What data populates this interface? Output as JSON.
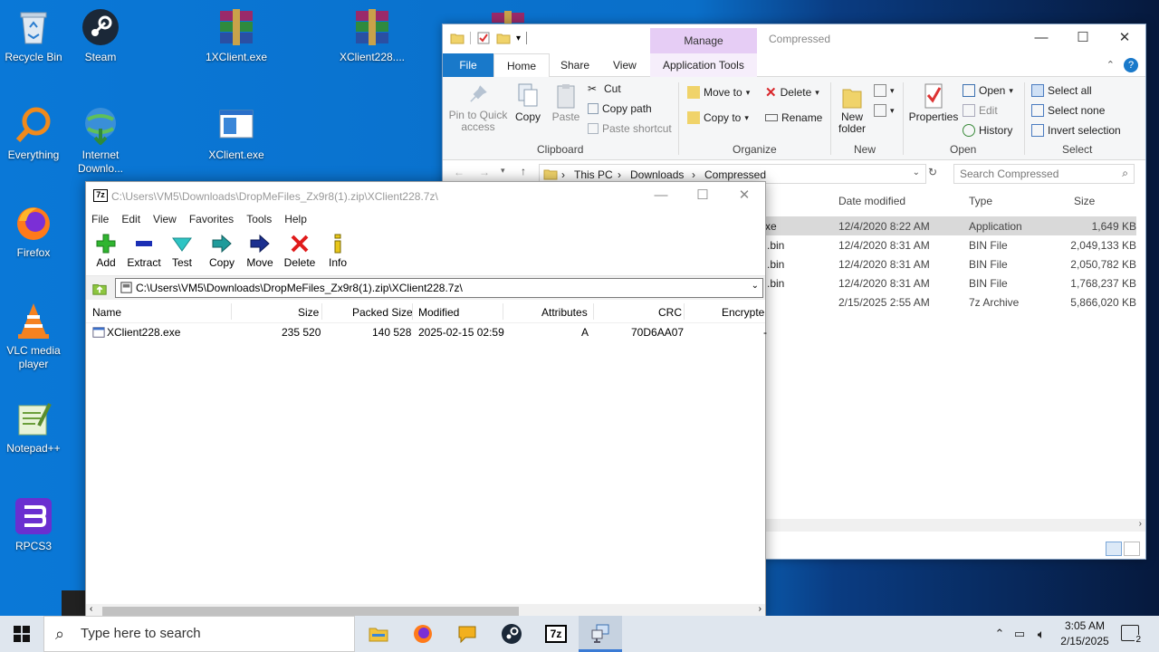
{
  "desktop": {
    "icons": [
      {
        "label": "Recycle Bin"
      },
      {
        "label": "Steam"
      },
      {
        "label": "1XClient.exe"
      },
      {
        "label": "XClient228...."
      },
      {
        "label": "Everything"
      },
      {
        "label": "Internet Downlo..."
      },
      {
        "label": "XClient.exe"
      },
      {
        "label": "Firefox"
      },
      {
        "label": "VLC media player"
      },
      {
        "label": "Notepad++"
      },
      {
        "label": "RPCS3"
      }
    ]
  },
  "explorer": {
    "title": "Compressed",
    "manage_tab": "Manage",
    "tabs": [
      "File",
      "Home",
      "Share",
      "View",
      "Application Tools"
    ],
    "ribbon": {
      "pin": "Pin to Quick access",
      "copy": "Copy",
      "paste": "Paste",
      "cut": "Cut",
      "copy_path": "Copy path",
      "paste_shortcut": "Paste shortcut",
      "group_clipboard": "Clipboard",
      "move_to": "Move to",
      "copy_to": "Copy to",
      "delete": "Delete",
      "rename": "Rename",
      "group_organize": "Organize",
      "new_folder": "New folder",
      "group_new": "New",
      "properties": "Properties",
      "open": "Open",
      "edit": "Edit",
      "history": "History",
      "group_open": "Open",
      "select_all": "Select all",
      "select_none": "Select none",
      "invert_selection": "Invert selection",
      "group_select": "Select"
    },
    "breadcrumb": [
      "This PC",
      "Downloads",
      "Compressed"
    ],
    "search_placeholder": "Search Compressed",
    "columns": {
      "modified": "Date modified",
      "type": "Type",
      "size": "Size"
    },
    "rows": [
      {
        "name": "xe",
        "modified": "12/4/2020 8:22 AM",
        "type": "Application",
        "size": "1,649 KB"
      },
      {
        "name": ".bin",
        "modified": "12/4/2020 8:31 AM",
        "type": "BIN File",
        "size": "2,049,133 KB"
      },
      {
        "name": ".bin",
        "modified": "12/4/2020 8:31 AM",
        "type": "BIN File",
        "size": "2,050,782 KB"
      },
      {
        "name": ".bin",
        "modified": "12/4/2020 8:31 AM",
        "type": "BIN File",
        "size": "1,768,237 KB"
      },
      {
        "name": "",
        "modified": "2/15/2025 2:55 AM",
        "type": "7z Archive",
        "size": "5,866,020 KB"
      }
    ]
  },
  "sevenzip": {
    "title": "C:\\Users\\VM5\\Downloads\\DropMeFiles_Zx9r8(1).zip\\XClient228.7z\\",
    "menu": [
      "File",
      "Edit",
      "View",
      "Favorites",
      "Tools",
      "Help"
    ],
    "tools": [
      "Add",
      "Extract",
      "Test",
      "Copy",
      "Move",
      "Delete",
      "Info"
    ],
    "path": "C:\\Users\\VM5\\Downloads\\DropMeFiles_Zx9r8(1).zip\\XClient228.7z\\",
    "columns": {
      "name": "Name",
      "size": "Size",
      "packed": "Packed Size",
      "modified": "Modified",
      "attributes": "Attributes",
      "crc": "CRC",
      "encrypted": "Encrypte"
    },
    "rows": [
      {
        "name": "XClient228.exe",
        "size": "235 520",
        "packed": "140 528",
        "modified": "2025-02-15 02:59",
        "attributes": "A",
        "crc": "70D6AA07",
        "encrypted": "-"
      }
    ]
  },
  "taskbar": {
    "search_placeholder": "Type here to search",
    "time": "3:05 AM",
    "date": "2/15/2025",
    "notifications": "2"
  },
  "colors": {
    "accent": "#1979ca",
    "manage": "#e6cdf5"
  }
}
